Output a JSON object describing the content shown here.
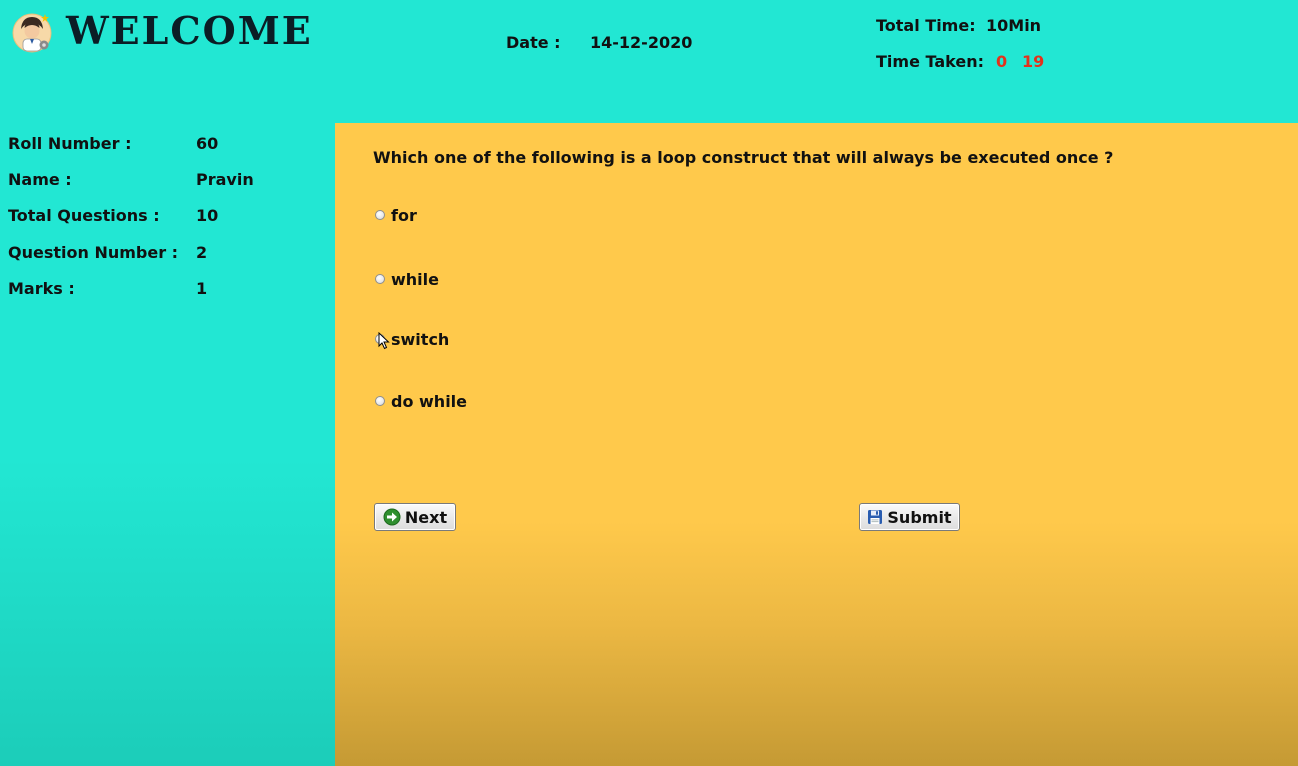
{
  "header": {
    "logo_icon": "student-avatar-icon",
    "title": "WELCOME",
    "date_label": "Date :",
    "date_value": "14-12-2020",
    "total_time_label": "Total Time:",
    "total_time_value": "10Min",
    "time_taken_label": "Time Taken:",
    "time_taken_minutes": "0",
    "time_taken_seconds": "19"
  },
  "info": {
    "roll_number_label": "Roll Number :",
    "roll_number_value": "60",
    "name_label": "Name :",
    "name_value": "Pravin",
    "total_questions_label": "Total Questions :",
    "total_questions_value": "10",
    "question_number_label": "Question Number :",
    "question_number_value": "2",
    "marks_label": "Marks :",
    "marks_value": "1"
  },
  "quiz": {
    "question": "Which one of the following is a loop construct that will always be executed once ?",
    "options": [
      {
        "label": "for",
        "selected": false
      },
      {
        "label": "while",
        "selected": false
      },
      {
        "label": "switch",
        "selected": false
      },
      {
        "label": "do while",
        "selected": false
      }
    ],
    "next_label": "Next",
    "next_icon": "arrow-right-circle-icon",
    "submit_label": "Submit",
    "submit_icon": "floppy-disk-icon"
  },
  "colors": {
    "background": "#22e7d3",
    "panel": "#ffc94b",
    "timer": "#e3321c"
  }
}
